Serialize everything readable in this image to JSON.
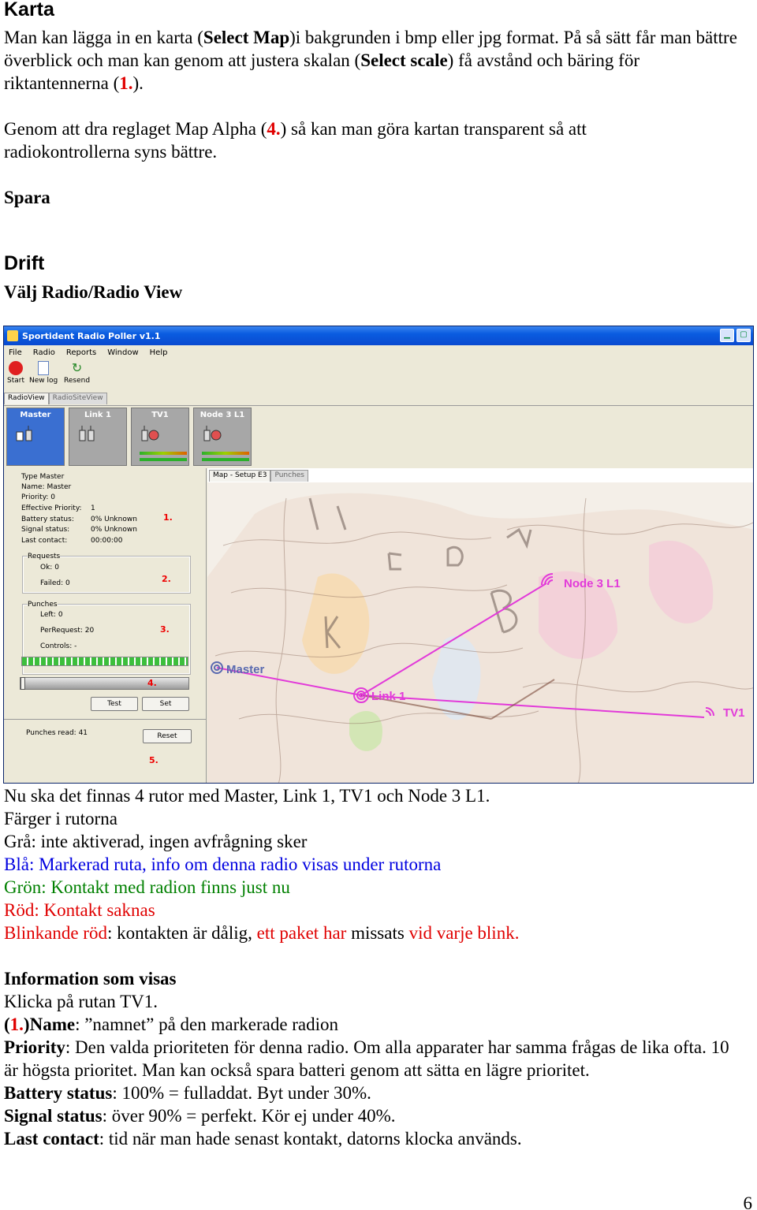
{
  "heading_karta": "Karta",
  "p1": {
    "a": "Man kan lägga in en karta (",
    "b": "Select Map",
    "c": ")i bakgrunden i bmp eller jpg format. På så sätt får man bättre överblick och man kan genom att justera skalan (",
    "d": "Select scale",
    "e": ") få avstånd och bäring för riktantennerna (",
    "f": "1.",
    "g": ")."
  },
  "p2": {
    "a": "Genom att dra reglaget Map Alpha (",
    "b": "4.",
    "c": ") så kan man göra kartan transparent så att radiokontrollerna syns bättre."
  },
  "spara": "Spara",
  "heading_drift": "Drift",
  "valj": "Välj Radio/Radio View",
  "app": {
    "title": "Sportident Radio Poller v1.1",
    "menu": [
      "File",
      "Radio",
      "Reports",
      "Window",
      "Help"
    ],
    "tools": [
      "Start",
      "New log",
      "Resend"
    ],
    "tabs": [
      "RadioView",
      "RadioSiteView"
    ],
    "radios": [
      "Master",
      "Link 1",
      "TV1",
      "Node 3 L1"
    ],
    "info": {
      "type": "Type   Master",
      "name": "Name: Master",
      "priority": "Priority:  0",
      "eff_label": "Effective Priority:",
      "eff_val": "1",
      "bat_label": "Battery status:",
      "bat_val": "0% Unknown",
      "sig_label": "Signal status:",
      "sig_val": "0% Unknown",
      "last_label": "Last contact:",
      "last_val": "00:00:00"
    },
    "requests": {
      "title": "Requests",
      "ok": "Ok:   0",
      "failed": "Failed:  0"
    },
    "punches": {
      "title": "Punches",
      "left": "Left:  0",
      "per": "PerRequest:  20",
      "controls": "Controls:  -"
    },
    "buttons": {
      "test": "Test",
      "set": "Set",
      "reset": "Reset"
    },
    "punches_read": "Punches read:   41",
    "nums": [
      "1.",
      "2.",
      "3.",
      "4.",
      "5."
    ],
    "map_tabs": [
      "Map - Setup E3",
      "Punches"
    ],
    "map_labels": [
      "Node 3 L1",
      "Master",
      "Link 1",
      "TV1"
    ]
  },
  "p3": "Nu ska det finnas 4 rutor med Master, Link 1, TV1 och Node 3 L1.",
  "farger": "Färger i rutorna",
  "gra": "Grå: inte aktiverad, ingen avfrågning sker",
  "bla": "Blå: Markerad ruta, info om denna radio visas under rutorna",
  "gron": "Grön: Kontakt med radion finns just nu",
  "rod": "Röd: Kontakt saknas",
  "blink": {
    "a": "Blinkande röd",
    "b": ": kontakten är dålig, ",
    "c": "ett paket har",
    "d": " missats ",
    "e": "vid varje blink."
  },
  "info_heading": "Information som visas",
  "klicka": "Klicka på rutan TV1.",
  "name_line": {
    "a": "(",
    "b": "1.",
    "c": ")Name",
    "d": ": ”namnet” på den markerade radion"
  },
  "priority_line": {
    "a": "Priority",
    "b": ": Den valda prioriteten för denna radio. Om alla apparater har samma frågas de lika ofta. 10 är högsta prioritet. Man kan också spara batteri genom att sätta en lägre prioritet."
  },
  "battery_line": {
    "a": "Battery status",
    "b": ": 100% = fulladdat. Byt under 30%."
  },
  "signal_line": {
    "a": "Signal status",
    "b": ": över 90% = perfekt. Kör ej under 40%."
  },
  "last_line": {
    "a": "Last contact",
    "b": ": tid när man hade senast kontakt, datorns klocka används."
  },
  "page_number": "6"
}
